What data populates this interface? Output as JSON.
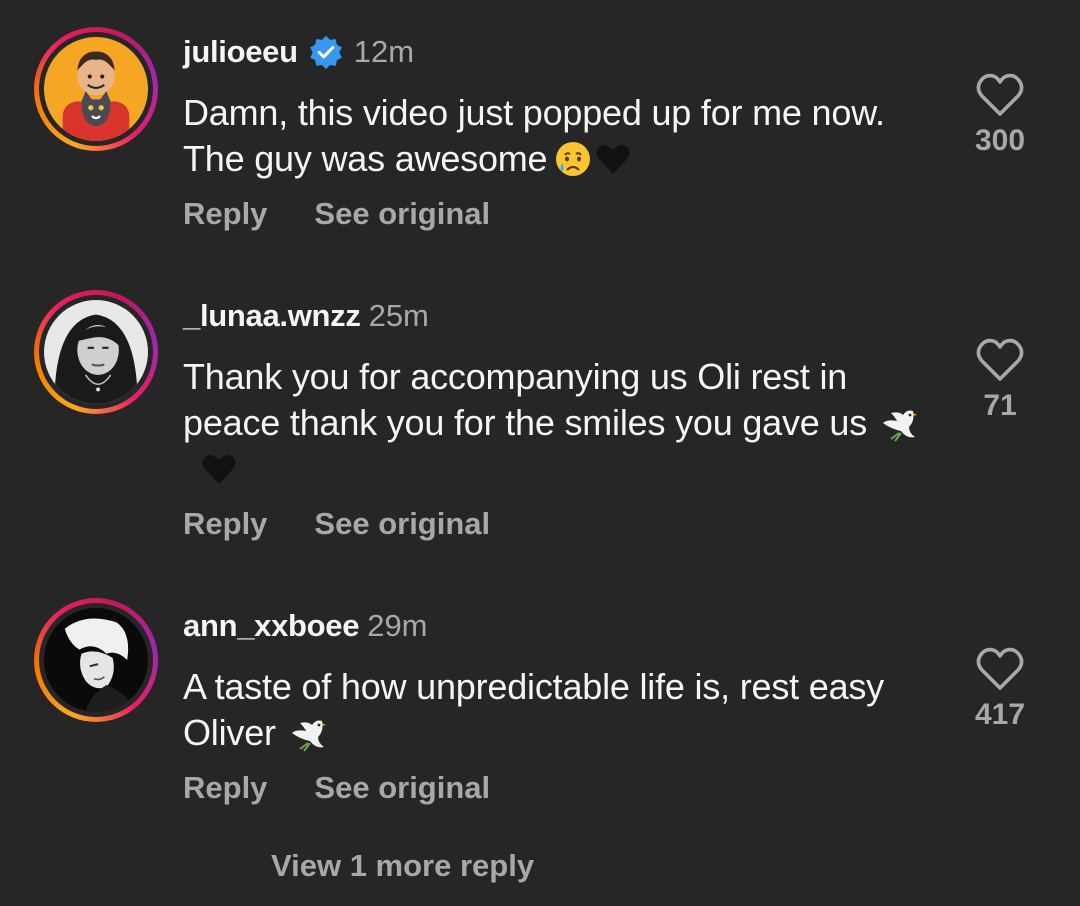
{
  "comments": [
    {
      "username": "julioeeu",
      "verified": true,
      "time": "12m",
      "text": "Damn, this video just popped up for me now. The guy was awesome",
      "emojis": [
        "crying-face-emoji",
        "black-heart-emoji"
      ],
      "reply_label": "Reply",
      "see_original_label": "See original",
      "likes": "300"
    },
    {
      "username": "_lunaa.wnzz",
      "verified": false,
      "time": "25m",
      "text": "Thank you for accompanying us Oli rest in peace thank you for the smiles you gave us",
      "emojis": [
        "dove-emoji",
        "black-heart-emoji"
      ],
      "reply_label": "Reply",
      "see_original_label": "See original",
      "likes": "71"
    },
    {
      "username": "ann_xxboee",
      "verified": false,
      "time": "29m",
      "text": "A taste of how unpredictable life is, rest easy Oliver",
      "emojis": [
        "dove-emoji"
      ],
      "reply_label": "Reply",
      "see_original_label": "See original",
      "likes": "417"
    }
  ],
  "view_more_replies": "View 1 more reply",
  "colors": {
    "background": "#262626",
    "primary_text": "#f5f5f5",
    "secondary_text": "#a8a8a8",
    "verified_badge": "#3897f0"
  }
}
